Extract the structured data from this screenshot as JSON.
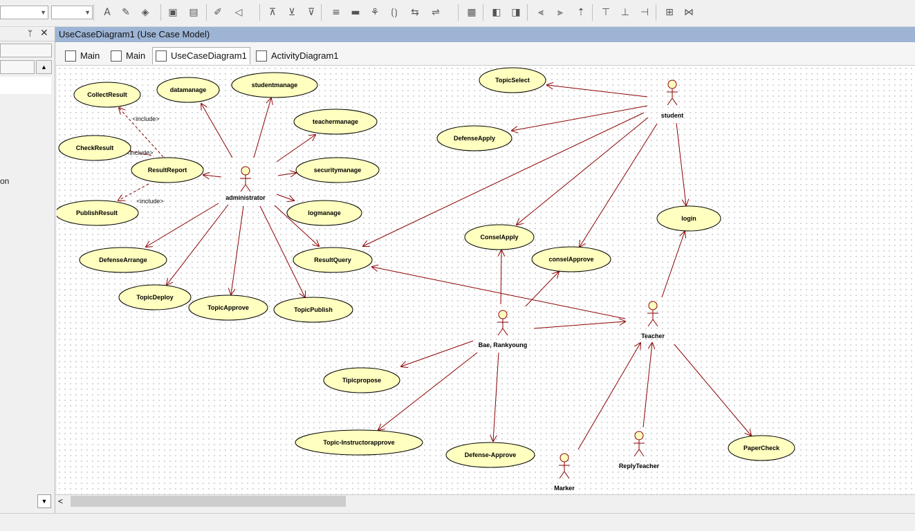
{
  "toolbar": {
    "icons": [
      "font-color-icon",
      "pen-icon",
      "fill-icon",
      "border-icon",
      "line-style-icon",
      "line-color-icon",
      "arrange-icon",
      "align-top-icon",
      "align-middle-icon",
      "align-bottom-icon",
      "wrap-icon",
      "fill-rect-icon",
      "paint-icon",
      "bracket-icon",
      "sort-icon",
      "shape-icon",
      "layout-icon",
      "bring-front-icon",
      "send-back-icon",
      "align-left-icon",
      "align-center-icon",
      "align-right-icon",
      "dist-top-icon",
      "dist-center-icon",
      "dist-bottom-icon",
      "same-width-icon",
      "same-height-icon"
    ]
  },
  "left_panel": {
    "pin_glyph": "ᛘ",
    "close_glyph": "✕",
    "partial_text": "on"
  },
  "document": {
    "title": "UseCaseDiagram1 (Use Case Model)"
  },
  "tabs": [
    {
      "label": "Main",
      "active": false
    },
    {
      "label": "Main",
      "active": false
    },
    {
      "label": "UseCaseDiagram1",
      "active": true
    },
    {
      "label": "ActivityDiagram1",
      "active": false
    }
  ],
  "diagram": {
    "actors": [
      {
        "id": "administrator",
        "label": "administrator"
      },
      {
        "id": "student",
        "label": "student"
      },
      {
        "id": "bae",
        "label": "Bae, Rankyoung"
      },
      {
        "id": "teacher",
        "label": "Teacher"
      },
      {
        "id": "replyteacher",
        "label": "ReplyTeacher"
      },
      {
        "id": "marker",
        "label": "Marker"
      }
    ],
    "usecases": [
      {
        "id": "collectresult",
        "label": "CollectResult"
      },
      {
        "id": "datamanage",
        "label": "datamanage"
      },
      {
        "id": "studentmanage",
        "label": "studentmanage"
      },
      {
        "id": "teachermanage",
        "label": "teachermanage"
      },
      {
        "id": "checkresult",
        "label": "CheckResult"
      },
      {
        "id": "resultreport",
        "label": "ResultReport"
      },
      {
        "id": "securitymanage",
        "label": "securitymanage"
      },
      {
        "id": "publishresult",
        "label": "PublishResult"
      },
      {
        "id": "logmanage",
        "label": "logmanage"
      },
      {
        "id": "defensearrange",
        "label": "DefenseArrange"
      },
      {
        "id": "resultquery",
        "label": "ResultQuery"
      },
      {
        "id": "topicdeploy",
        "label": "TopicDeploy"
      },
      {
        "id": "topicapprove",
        "label": "TopicApprove"
      },
      {
        "id": "topicpublish",
        "label": "TopicPublish"
      },
      {
        "id": "topicselect",
        "label": "TopicSelect"
      },
      {
        "id": "defenseapply",
        "label": "DefenseApply"
      },
      {
        "id": "login",
        "label": "login"
      },
      {
        "id": "conselapply",
        "label": "ConselApply"
      },
      {
        "id": "conselapprove",
        "label": "conselApprove"
      },
      {
        "id": "tipicpropose",
        "label": "Tipicpropose"
      },
      {
        "id": "topicinstructor",
        "label": "Topic-Instructorapprove"
      },
      {
        "id": "defenseapprove",
        "label": "Defense-Approve"
      },
      {
        "id": "papercheck",
        "label": "PaperCheck"
      }
    ],
    "include_labels": [
      "<include>",
      "<include>",
      "<include>"
    ]
  },
  "colors": {
    "usecase_fill": "#ffffc0",
    "usecase_stroke": "#000000",
    "line": "#8b0000",
    "title_bar": "#9db4d5"
  }
}
